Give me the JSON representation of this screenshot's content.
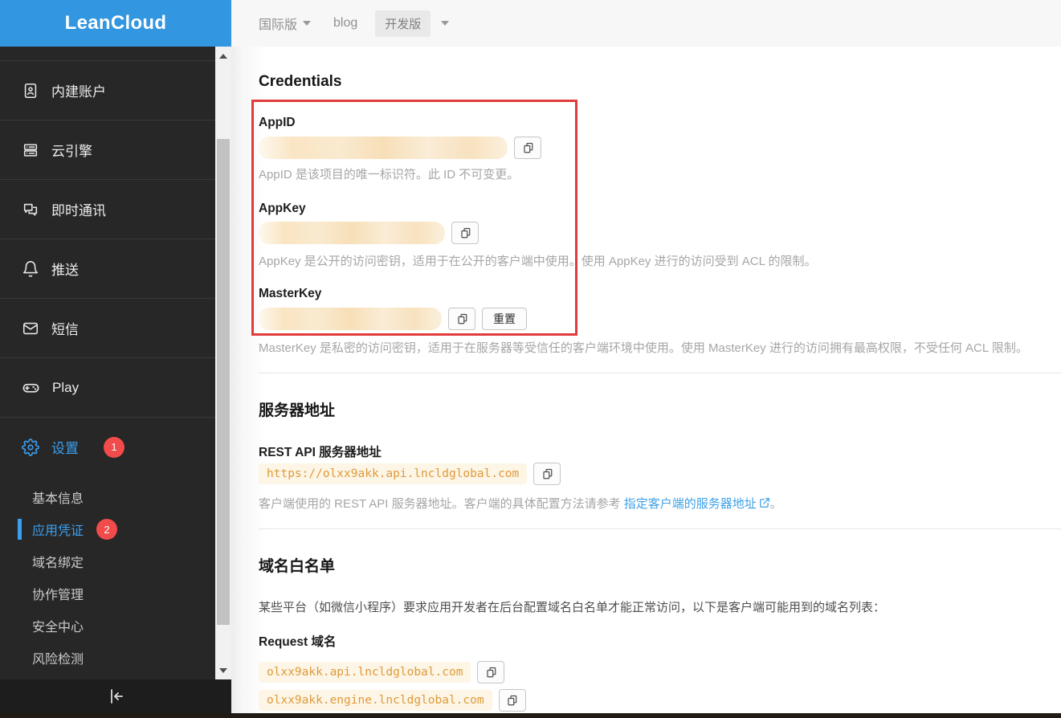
{
  "header": {
    "logo": "LeanCloud",
    "topbar": {
      "region_label": "国际版",
      "blog_label": "blog",
      "version_label": "开发版"
    }
  },
  "sidebar": {
    "items": [
      {
        "label": "内建账户",
        "icon": "id-card-icon"
      },
      {
        "label": "云引擎",
        "icon": "server-icon"
      },
      {
        "label": "即时通讯",
        "icon": "chat-bubbles-icon"
      },
      {
        "label": "推送",
        "icon": "bell-icon"
      },
      {
        "label": "短信",
        "icon": "mail-icon"
      },
      {
        "label": "Play",
        "icon": "gamepad-icon"
      },
      {
        "label": "设置",
        "icon": "gear-icon",
        "badge": "1"
      }
    ],
    "submenu": [
      {
        "label": "基本信息"
      },
      {
        "label": "应用凭证",
        "badge": "2",
        "active": true
      },
      {
        "label": "域名绑定"
      },
      {
        "label": "协作管理"
      },
      {
        "label": "安全中心"
      },
      {
        "label": "风险检测"
      }
    ]
  },
  "main": {
    "credentials": {
      "title": "Credentials",
      "fields": [
        {
          "label": "AppID",
          "desc": "AppID 是该项目的唯一标识符。此 ID 不可变更。"
        },
        {
          "label": "AppKey",
          "desc": "AppKey 是公开的访问密钥，适用于在公开的客户端中使用。使用 AppKey 进行的访问受到 ACL 的限制。"
        },
        {
          "label": "MasterKey",
          "desc": "MasterKey 是私密的访问密钥，适用于在服务器等受信任的客户端环境中使用。使用 MasterKey 进行的访问拥有最高权限，不受任何 ACL 限制。",
          "reset_label": "重置"
        }
      ]
    },
    "server": {
      "title": "服务器地址",
      "rest_label": "REST API 服务器地址",
      "rest_url": "https://olxx9akk.api.lncldglobal.com",
      "desc_prefix": "客户端使用的 REST API 服务器地址。客户端的具体配置方法请参考 ",
      "link_label": "指定客户端的服务器地址",
      "desc_suffix": "。"
    },
    "whitelist": {
      "title": "域名白名单",
      "desc": "某些平台（如微信小程序）要求应用开发者在后台配置域名白名单才能正常访问，以下是客户端可能用到的域名列表：",
      "request_label": "Request 域名",
      "domains": [
        "olxx9akk.api.lncldglobal.com",
        "olxx9akk.engine.lncldglobal.com"
      ]
    }
  },
  "colors": {
    "header_blue": "#3296e0",
    "sidebar_bg": "#272727",
    "active_blue": "#3b9ff0",
    "badge_red": "#f14b4b",
    "code_orange": "#df9b3d",
    "code_bg": "#fdf5e5",
    "annotation_red": "#e23b3b",
    "link_blue": "#3da1e8"
  }
}
